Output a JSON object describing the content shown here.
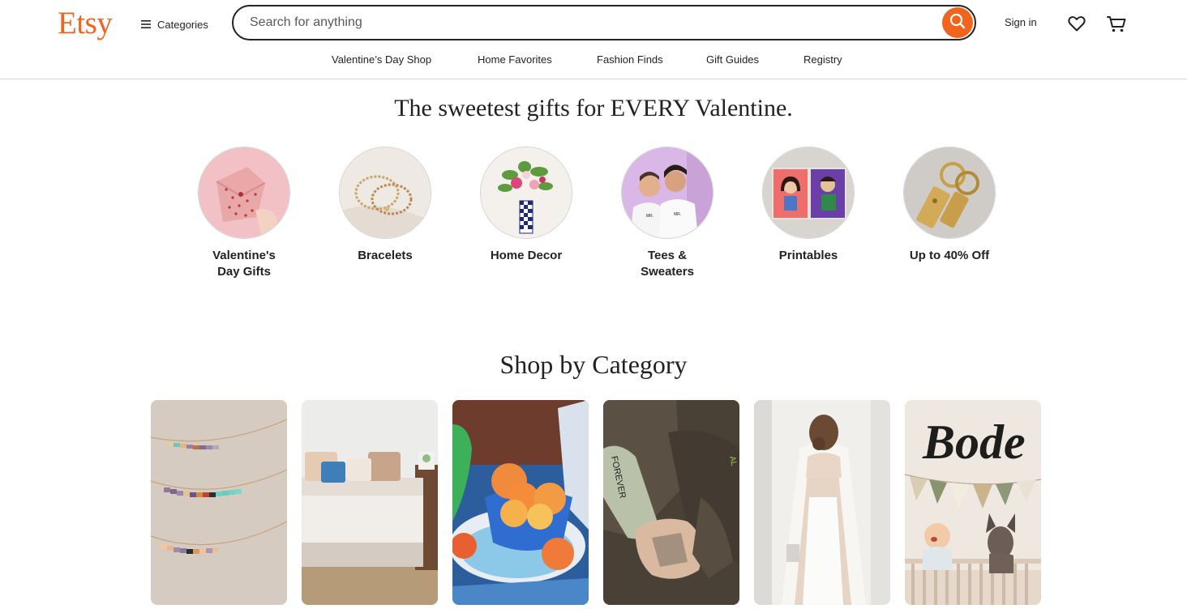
{
  "header": {
    "logo": "Etsy",
    "categories_label": "Categories",
    "search_placeholder": "Search for anything",
    "sign_in": "Sign in"
  },
  "subnav": [
    "Valentine’s Day Shop",
    "Home Favorites",
    "Fashion Finds",
    "Gift Guides",
    "Registry"
  ],
  "hero": {
    "title": "The sweetest gifts for EVERY Valentine."
  },
  "circles": [
    {
      "label": "Valentine's\nDay Gifts"
    },
    {
      "label": "Bracelets"
    },
    {
      "label": "Home Decor"
    },
    {
      "label": "Tees &\nSweaters"
    },
    {
      "label": "Printables"
    },
    {
      "label": "Up to 40% Off"
    }
  ],
  "shop_by_category": {
    "title": "Shop by Category",
    "card_sign_text": "Bode"
  },
  "colors": {
    "brand": "#F1641E",
    "text": "#222222"
  },
  "icons": [
    "hamburger-icon",
    "search-icon",
    "heart-icon",
    "cart-icon"
  ]
}
